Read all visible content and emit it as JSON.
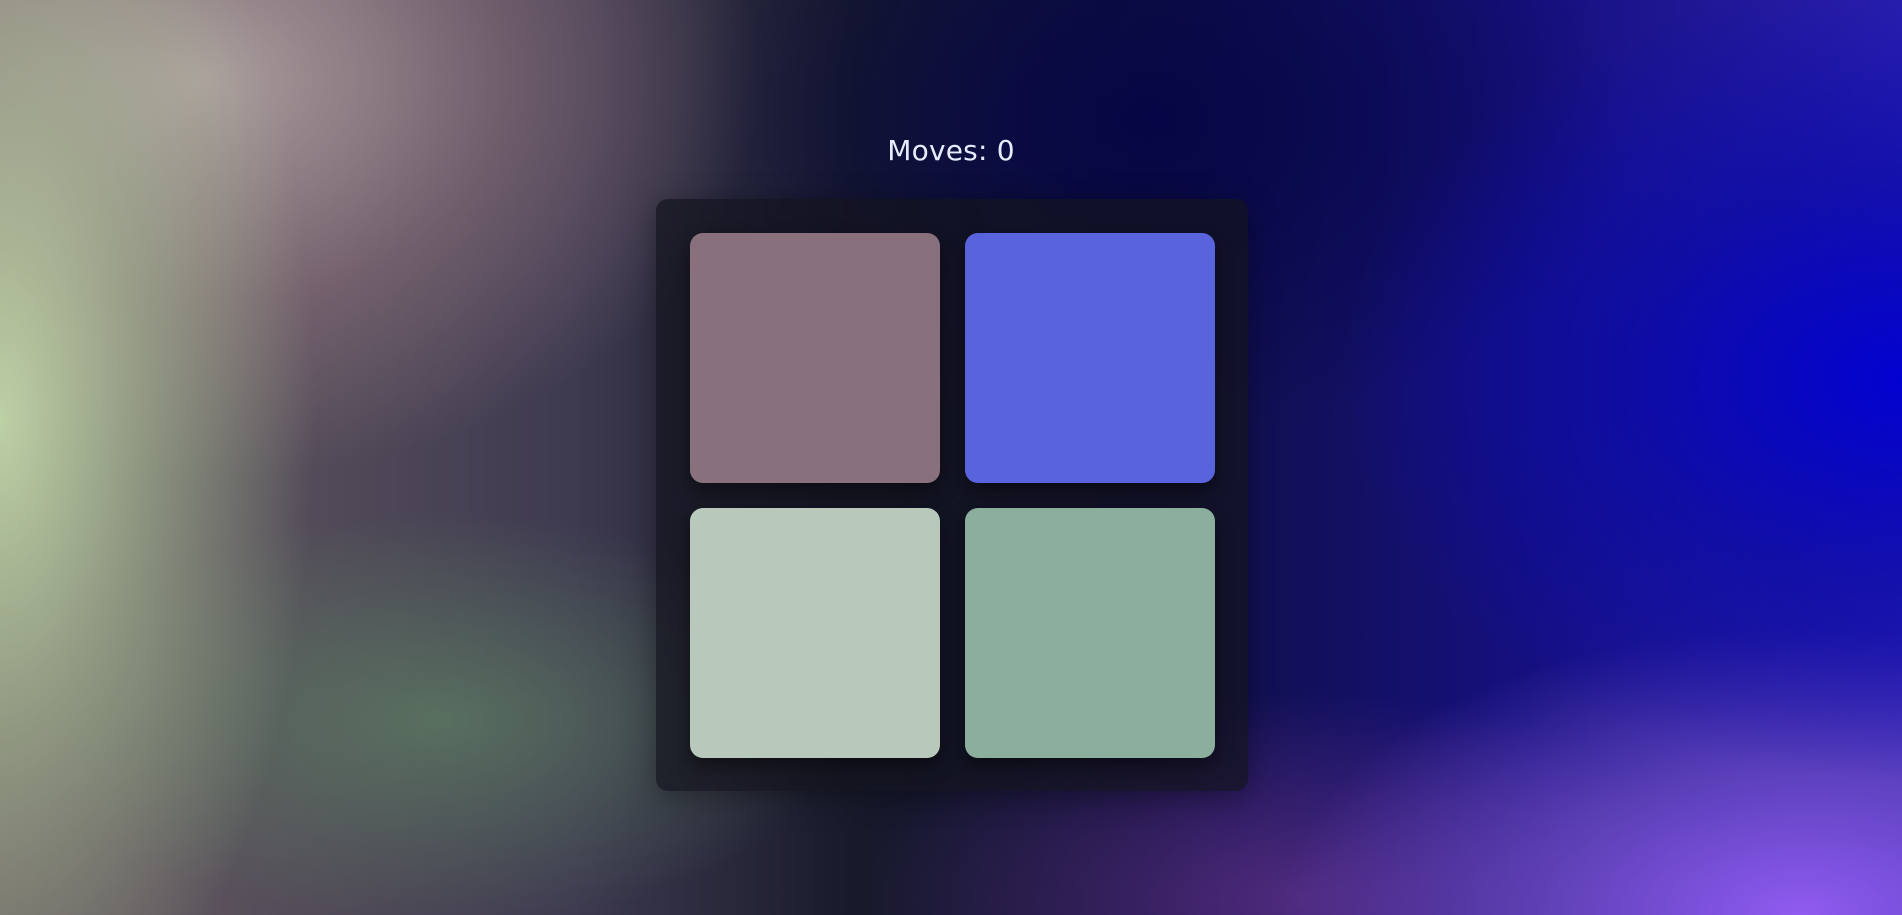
{
  "status": {
    "moves_label": "Moves: 0"
  },
  "board": {
    "tiles": [
      {
        "color": "#88707c"
      },
      {
        "color": "#5963dd"
      },
      {
        "color": "#b8c9bb"
      },
      {
        "color": "#8cae9c"
      }
    ]
  }
}
